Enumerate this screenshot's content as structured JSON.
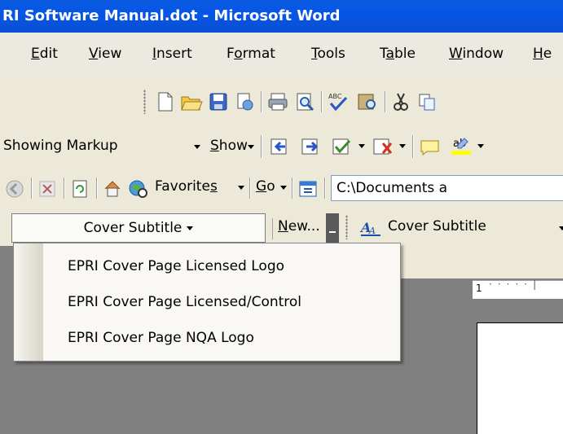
{
  "window": {
    "title": "RI Software Manual.dot - Microsoft Word"
  },
  "menubar": {
    "items": [
      {
        "label": "Edit",
        "accel": "E",
        "rest": "dit"
      },
      {
        "label": "View",
        "accel": "V",
        "rest": "iew"
      },
      {
        "label": "Insert",
        "accel": "I",
        "rest": "nsert"
      },
      {
        "label": "Format",
        "pre": "F",
        "accel": "o",
        "rest": "rmat"
      },
      {
        "label": "Tools",
        "accel": "T",
        "rest": "ools"
      },
      {
        "label": "Table",
        "pre": "T",
        "accel": "a",
        "rest": "ble"
      },
      {
        "label": "Window",
        "accel": "W",
        "rest": "indow"
      },
      {
        "label": "He",
        "accel": "H",
        "rest": "e"
      }
    ]
  },
  "reviewing": {
    "display_combo": "Showing Markup",
    "show_pre": "",
    "show_accel": "S",
    "show_rest": "how"
  },
  "web": {
    "favorites_pre": "Favorite",
    "favorites_accel": "s",
    "go_accel": "G",
    "go_rest": "o",
    "address": "C:\\Documents a"
  },
  "style_bar": {
    "style_button": "Cover Subtitle",
    "new_pre": "",
    "new_accel": "N",
    "new_rest": "ew...",
    "style_combo": "Cover Subtitle"
  },
  "style_menu": {
    "items": [
      "EPRI Cover Page Licensed Logo",
      "EPRI Cover Page Licensed/Control",
      "EPRI Cover Page NQA Logo"
    ]
  },
  "ruler": {
    "label": "1"
  }
}
